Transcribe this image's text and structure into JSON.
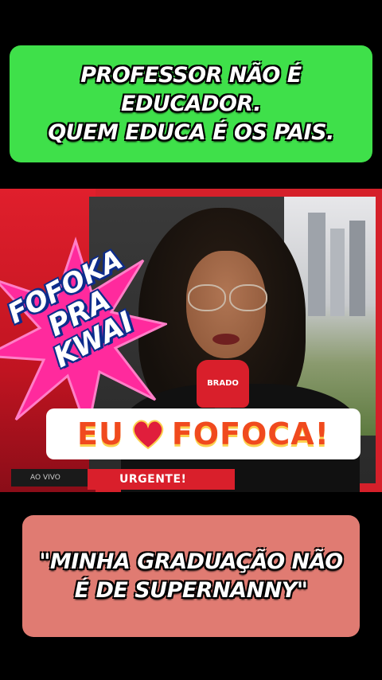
{
  "top_caption": {
    "line1": "PROFESSOR NÃO É EDUCADOR.",
    "line2": "QUEM EDUCA É OS PAIS."
  },
  "video": {
    "sticker_line1": "FOFOKA",
    "sticker_line2": "PRA KWAI",
    "love_left": "EU",
    "love_right": "FOFOCA!",
    "mic_brand": "BRADO",
    "live_label": "AO VIVO",
    "urgent_label": "URGENTE!"
  },
  "bottom_caption": {
    "line1": "\"MINHA GRADUAÇÃO NÃO",
    "line2": "É DE SUPERNANNY\""
  },
  "colors": {
    "top_bg": "#3fe04a",
    "bottom_bg": "#e07b72",
    "brand_red": "#d91f2b",
    "burst_pink": "#ff2a9d",
    "love_orange": "#f04a1e"
  },
  "icons": [
    "heart-icon"
  ]
}
